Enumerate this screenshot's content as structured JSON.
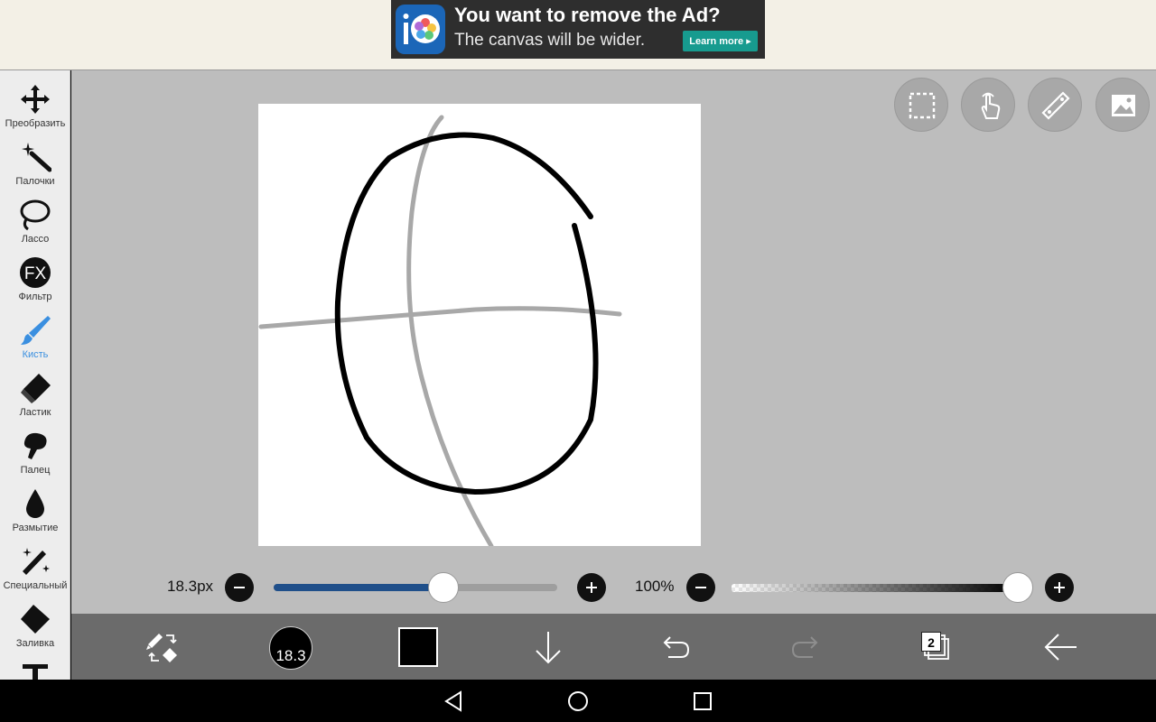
{
  "ad": {
    "headline": "You want to remove the Ad?",
    "subtext": "The canvas will be wider.",
    "button_label": "Learn more ▸"
  },
  "tools": [
    {
      "id": "transform",
      "label": "Преобразить",
      "icon": "move-arrows-icon"
    },
    {
      "id": "magic-wand",
      "label": "Палочки",
      "icon": "magic-wand-icon"
    },
    {
      "id": "lasso",
      "label": "Лассо",
      "icon": "lasso-icon"
    },
    {
      "id": "filter",
      "label": "Фильтр",
      "icon": "fx-icon"
    },
    {
      "id": "brush",
      "label": "Кисть",
      "icon": "brush-icon",
      "active": true
    },
    {
      "id": "eraser",
      "label": "Ластик",
      "icon": "eraser-icon"
    },
    {
      "id": "finger",
      "label": "Палец",
      "icon": "finger-smudge-icon"
    },
    {
      "id": "blur",
      "label": "Размытие",
      "icon": "droplet-icon"
    },
    {
      "id": "special",
      "label": "Специальный",
      "icon": "sparkle-wand-icon"
    },
    {
      "id": "fill",
      "label": "Заливка",
      "icon": "fill-bucket-icon"
    },
    {
      "id": "text",
      "label": "",
      "icon": "text-icon"
    }
  ],
  "fabs": [
    "selection-icon",
    "hand-touch-icon",
    "ruler-icon",
    "image-icon"
  ],
  "brush": {
    "size_label": "18.3px",
    "size_fraction": 0.6,
    "opacity_label": "100%",
    "opacity_fraction": 1.0,
    "size_circle_label": "18.3"
  },
  "bottombar": {
    "layers_count": "2",
    "color_hex": "#000000"
  },
  "colors": {
    "accent": "#3a8fe0",
    "slider_fill": "#1f4f8a"
  }
}
